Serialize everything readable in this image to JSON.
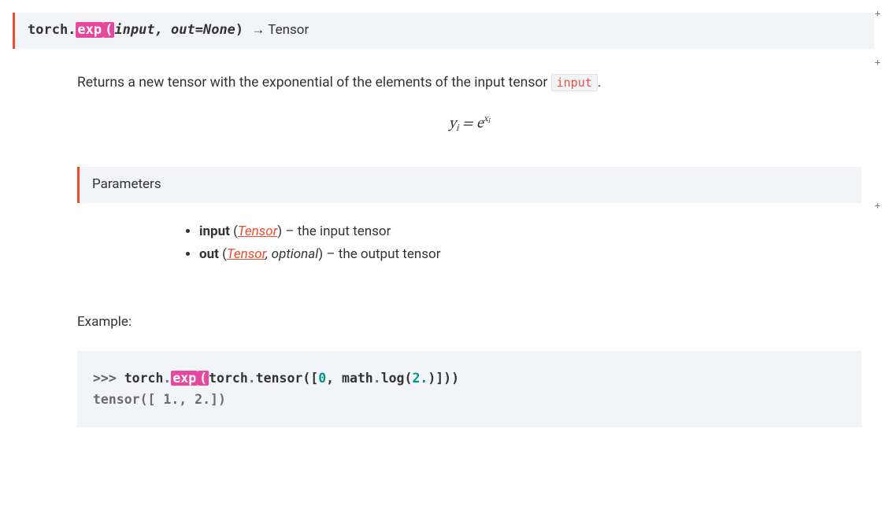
{
  "signature": {
    "module": "torch.",
    "func": "exp",
    "open": "(",
    "args": "input, out=None",
    "close": ") ",
    "arrow": "→ Tensor"
  },
  "description": {
    "pre": "Returns a new tensor with the exponential of the elements of the input tensor ",
    "code": "input",
    "post": "."
  },
  "formula": {
    "y": "y",
    "sub_i_1": "i",
    "eq": " = e",
    "sup_x": "x",
    "sup_i": "i"
  },
  "params_heading": "Parameters",
  "params": [
    {
      "name": "input",
      "typelink": "Tensor",
      "optional": "",
      "desc": " – the input tensor"
    },
    {
      "name": "out",
      "typelink": "Tensor",
      "optional": ", optional",
      "desc": " – the output tensor"
    }
  ],
  "example_label": "Example:",
  "code_example": {
    "line1": {
      "prompt": ">>> ",
      "torch1": "torch",
      "dot1": ".",
      "hi_exp": "exp",
      "hi_open": "(",
      "torch2": "torch",
      "dot2": ".",
      "tensor_fn": "tensor",
      "args_pre": "([",
      "num0": "0",
      "mid": ", math",
      "dot3": ".",
      "log_fn": "log",
      "open2": "(",
      "num2": "2.",
      "close_seq": ")]))"
    },
    "line2": "tensor([ 1.,  2.])"
  },
  "plus_buttons": {
    "a": "+",
    "b": "+",
    "c": "+"
  }
}
